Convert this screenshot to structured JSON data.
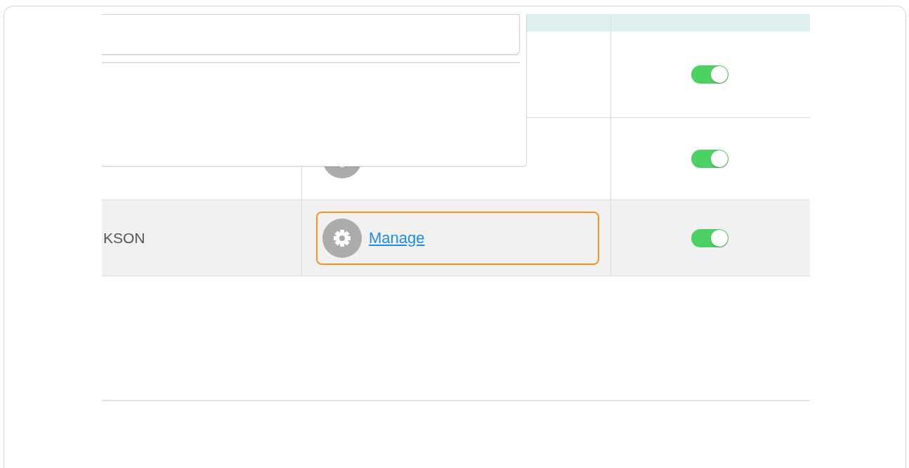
{
  "popup": {
    "open": true
  },
  "table": {
    "rows": [
      {
        "on": true,
        "selected": false,
        "gear": false
      },
      {
        "on": true,
        "selected": false,
        "gear": true
      },
      {
        "name": "KSON",
        "link": "Manage",
        "highlighted": true,
        "on": true,
        "selected": true,
        "gear": true
      }
    ]
  }
}
